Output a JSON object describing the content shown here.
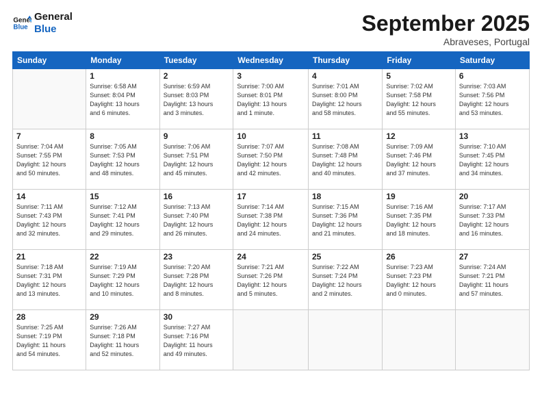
{
  "logo": {
    "line1": "General",
    "line2": "Blue"
  },
  "title": "September 2025",
  "location": "Abraveses, Portugal",
  "weekdays": [
    "Sunday",
    "Monday",
    "Tuesday",
    "Wednesday",
    "Thursday",
    "Friday",
    "Saturday"
  ],
  "weeks": [
    [
      {
        "day": "",
        "info": ""
      },
      {
        "day": "1",
        "info": "Sunrise: 6:58 AM\nSunset: 8:04 PM\nDaylight: 13 hours\nand 6 minutes."
      },
      {
        "day": "2",
        "info": "Sunrise: 6:59 AM\nSunset: 8:03 PM\nDaylight: 13 hours\nand 3 minutes."
      },
      {
        "day": "3",
        "info": "Sunrise: 7:00 AM\nSunset: 8:01 PM\nDaylight: 13 hours\nand 1 minute."
      },
      {
        "day": "4",
        "info": "Sunrise: 7:01 AM\nSunset: 8:00 PM\nDaylight: 12 hours\nand 58 minutes."
      },
      {
        "day": "5",
        "info": "Sunrise: 7:02 AM\nSunset: 7:58 PM\nDaylight: 12 hours\nand 55 minutes."
      },
      {
        "day": "6",
        "info": "Sunrise: 7:03 AM\nSunset: 7:56 PM\nDaylight: 12 hours\nand 53 minutes."
      }
    ],
    [
      {
        "day": "7",
        "info": "Sunrise: 7:04 AM\nSunset: 7:55 PM\nDaylight: 12 hours\nand 50 minutes."
      },
      {
        "day": "8",
        "info": "Sunrise: 7:05 AM\nSunset: 7:53 PM\nDaylight: 12 hours\nand 48 minutes."
      },
      {
        "day": "9",
        "info": "Sunrise: 7:06 AM\nSunset: 7:51 PM\nDaylight: 12 hours\nand 45 minutes."
      },
      {
        "day": "10",
        "info": "Sunrise: 7:07 AM\nSunset: 7:50 PM\nDaylight: 12 hours\nand 42 minutes."
      },
      {
        "day": "11",
        "info": "Sunrise: 7:08 AM\nSunset: 7:48 PM\nDaylight: 12 hours\nand 40 minutes."
      },
      {
        "day": "12",
        "info": "Sunrise: 7:09 AM\nSunset: 7:46 PM\nDaylight: 12 hours\nand 37 minutes."
      },
      {
        "day": "13",
        "info": "Sunrise: 7:10 AM\nSunset: 7:45 PM\nDaylight: 12 hours\nand 34 minutes."
      }
    ],
    [
      {
        "day": "14",
        "info": "Sunrise: 7:11 AM\nSunset: 7:43 PM\nDaylight: 12 hours\nand 32 minutes."
      },
      {
        "day": "15",
        "info": "Sunrise: 7:12 AM\nSunset: 7:41 PM\nDaylight: 12 hours\nand 29 minutes."
      },
      {
        "day": "16",
        "info": "Sunrise: 7:13 AM\nSunset: 7:40 PM\nDaylight: 12 hours\nand 26 minutes."
      },
      {
        "day": "17",
        "info": "Sunrise: 7:14 AM\nSunset: 7:38 PM\nDaylight: 12 hours\nand 24 minutes."
      },
      {
        "day": "18",
        "info": "Sunrise: 7:15 AM\nSunset: 7:36 PM\nDaylight: 12 hours\nand 21 minutes."
      },
      {
        "day": "19",
        "info": "Sunrise: 7:16 AM\nSunset: 7:35 PM\nDaylight: 12 hours\nand 18 minutes."
      },
      {
        "day": "20",
        "info": "Sunrise: 7:17 AM\nSunset: 7:33 PM\nDaylight: 12 hours\nand 16 minutes."
      }
    ],
    [
      {
        "day": "21",
        "info": "Sunrise: 7:18 AM\nSunset: 7:31 PM\nDaylight: 12 hours\nand 13 minutes."
      },
      {
        "day": "22",
        "info": "Sunrise: 7:19 AM\nSunset: 7:29 PM\nDaylight: 12 hours\nand 10 minutes."
      },
      {
        "day": "23",
        "info": "Sunrise: 7:20 AM\nSunset: 7:28 PM\nDaylight: 12 hours\nand 8 minutes."
      },
      {
        "day": "24",
        "info": "Sunrise: 7:21 AM\nSunset: 7:26 PM\nDaylight: 12 hours\nand 5 minutes."
      },
      {
        "day": "25",
        "info": "Sunrise: 7:22 AM\nSunset: 7:24 PM\nDaylight: 12 hours\nand 2 minutes."
      },
      {
        "day": "26",
        "info": "Sunrise: 7:23 AM\nSunset: 7:23 PM\nDaylight: 12 hours\nand 0 minutes."
      },
      {
        "day": "27",
        "info": "Sunrise: 7:24 AM\nSunset: 7:21 PM\nDaylight: 11 hours\nand 57 minutes."
      }
    ],
    [
      {
        "day": "28",
        "info": "Sunrise: 7:25 AM\nSunset: 7:19 PM\nDaylight: 11 hours\nand 54 minutes."
      },
      {
        "day": "29",
        "info": "Sunrise: 7:26 AM\nSunset: 7:18 PM\nDaylight: 11 hours\nand 52 minutes."
      },
      {
        "day": "30",
        "info": "Sunrise: 7:27 AM\nSunset: 7:16 PM\nDaylight: 11 hours\nand 49 minutes."
      },
      {
        "day": "",
        "info": ""
      },
      {
        "day": "",
        "info": ""
      },
      {
        "day": "",
        "info": ""
      },
      {
        "day": "",
        "info": ""
      }
    ]
  ]
}
